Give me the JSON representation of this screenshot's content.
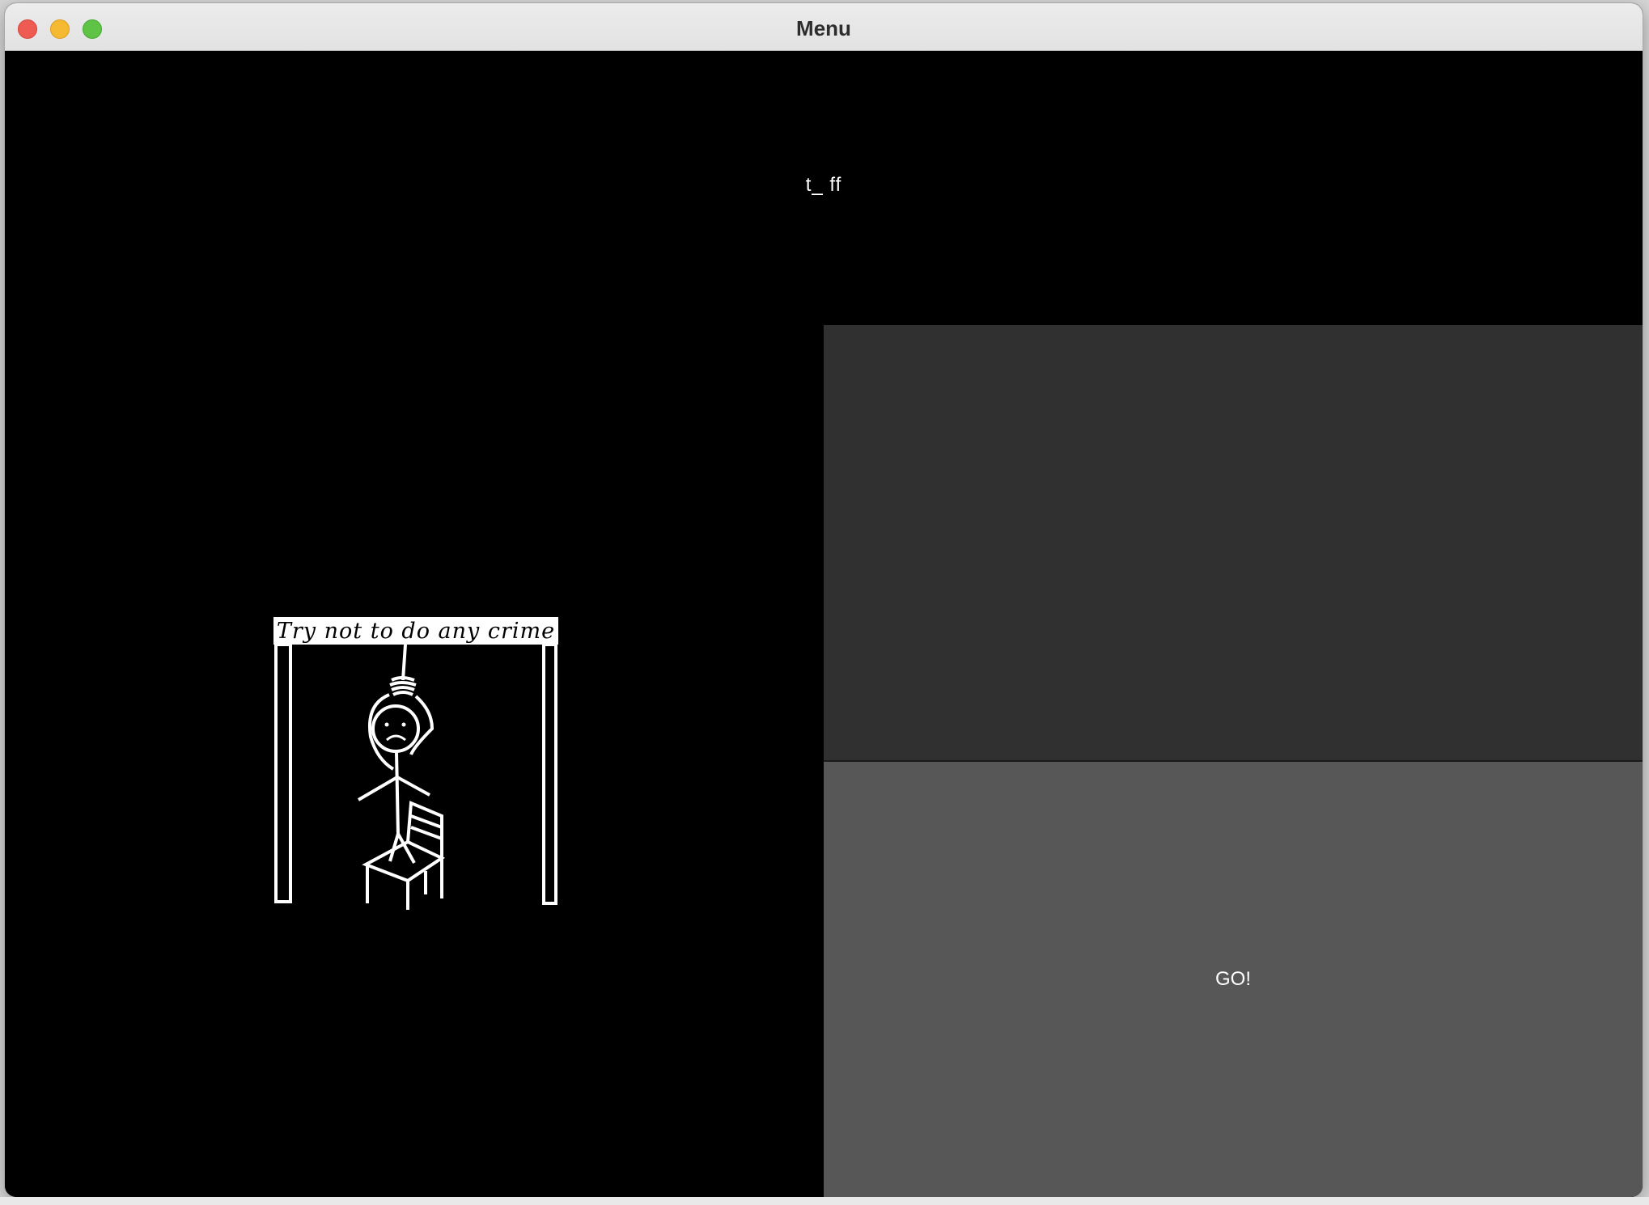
{
  "window": {
    "title": "Menu"
  },
  "game": {
    "word_display": "t_ ff",
    "hangman_sign": "Try not to do any crime",
    "go_button_label": "GO!"
  },
  "colors": {
    "background": "#000000",
    "panel_dark": "#303030",
    "panel_button": "#575757",
    "text": "#ffffff"
  },
  "icons": {
    "close": "close-icon",
    "minimize": "minimize-icon",
    "maximize": "maximize-icon"
  }
}
